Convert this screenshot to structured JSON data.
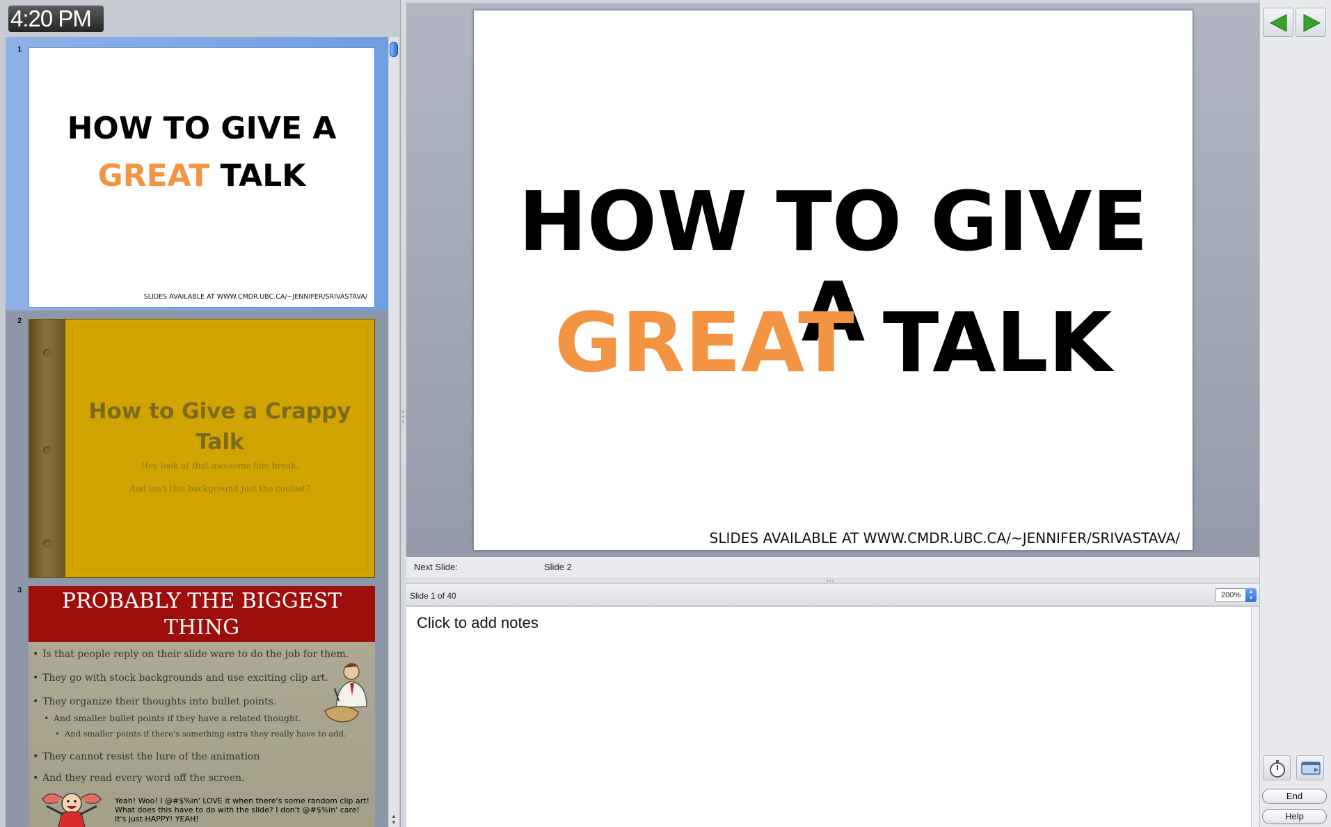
{
  "clock": {
    "time": "4:20 PM"
  },
  "thumbnails": [
    {
      "number": "1",
      "title_line1": "HOW TO GIVE A",
      "title_accent": "GREAT",
      "title_rest": "TALK",
      "footer": "SLIDES AVAILABLE AT WWW.CMDR.UBC.CA/~JENNIFER/SRIVASTAVA/"
    },
    {
      "number": "2",
      "title_line1": "How to Give a Crappy",
      "title_line2": "Talk",
      "sub1": "Hey look at that awesome line break.",
      "sub2": "And isn't this background just the coolest?"
    },
    {
      "number": "3",
      "heading_line1": "PROBABLY THE BIGGEST",
      "heading_line2": "THING",
      "bullets": [
        "Is that people reply on their slide ware to do the job for them.",
        "They go with stock backgrounds and use exciting clip art.",
        "They organize their thoughts into bullet points.",
        "And smaller bullet points if they have a related thought.",
        "And smaller points if there's something extra they really have to add.",
        "They cannot resist the lure of the animation",
        "And they read every word off the screen."
      ],
      "exclaim": "Yeah! Woo! I @#$%in' LOVE it when there's some random clip art! What does this have to do with the slide? I don't @#$%in' care! It's just HAPPY! YEAH!"
    }
  ],
  "current_slide": {
    "title_line1": "HOW TO GIVE A",
    "title_accent": "GREAT",
    "title_rest": "TALK",
    "footer": "SLIDES AVAILABLE AT WWW.CMDR.UBC.CA/~JENNIFER/SRIVASTAVA/"
  },
  "next_slide": {
    "label": "Next Slide:",
    "value": "Slide 2"
  },
  "notes_bar": {
    "slide_count": "Slide 1 of 40",
    "zoom": "200%"
  },
  "notes": {
    "placeholder": "Click to add notes"
  },
  "toolbar": {
    "end_label": "End",
    "help_label": "Help"
  },
  "colors": {
    "accent_orange": "#f39443",
    "nav_green": "#3aa12c",
    "slide2_gold": "#d2a402",
    "slide3_red": "#9d0d0a"
  },
  "icons": [
    "previous-arrow-icon",
    "next-arrow-icon",
    "stopwatch-icon",
    "screen-swap-icon"
  ]
}
